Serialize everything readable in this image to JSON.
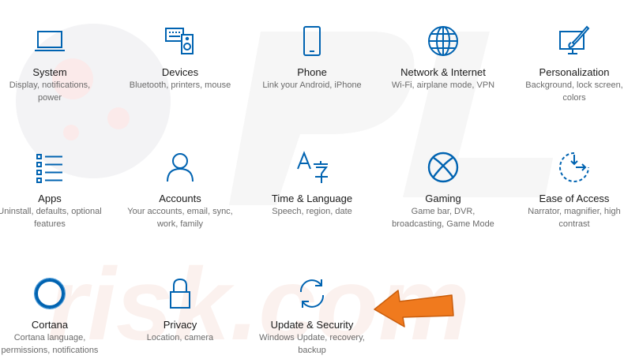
{
  "colors": {
    "accent": "#0063b1",
    "arrow": "#f07a1e"
  },
  "tiles": [
    {
      "title": "System",
      "desc1": "Display, notifications,",
      "desc2": "power",
      "icon": "laptop-icon"
    },
    {
      "title": "Devices",
      "desc1": "Bluetooth, printers, mouse",
      "desc2": "",
      "icon": "keyboard-speaker-icon"
    },
    {
      "title": "Phone",
      "desc1": "Link your Android, iPhone",
      "desc2": "",
      "icon": "phone-icon"
    },
    {
      "title": "Network & Internet",
      "desc1": "Wi-Fi, airplane mode, VPN",
      "desc2": "",
      "icon": "globe-icon"
    },
    {
      "title": "Personalization",
      "desc1": "Background, lock screen,",
      "desc2": "colors",
      "icon": "paint-brush-icon"
    },
    {
      "title": "Apps",
      "desc1": "Uninstall, defaults, optional",
      "desc2": "features",
      "icon": "apps-list-icon"
    },
    {
      "title": "Accounts",
      "desc1": "Your accounts, email, sync,",
      "desc2": "work, family",
      "icon": "person-icon"
    },
    {
      "title": "Time & Language",
      "desc1": "Speech, region, date",
      "desc2": "",
      "icon": "time-language-icon"
    },
    {
      "title": "Gaming",
      "desc1": "Game bar, DVR,",
      "desc2": "broadcasting, Game Mode",
      "icon": "xbox-icon"
    },
    {
      "title": "Ease of Access",
      "desc1": "Narrator, magnifier, high",
      "desc2": "contrast",
      "icon": "ease-of-access-icon"
    },
    {
      "title": "Cortana",
      "desc1": "Cortana language,",
      "desc2": "permissions, notifications",
      "icon": "cortana-icon"
    },
    {
      "title": "Privacy",
      "desc1": "Location, camera",
      "desc2": "",
      "icon": "lock-icon"
    },
    {
      "title": "Update & Security",
      "desc1": "Windows Update, recovery,",
      "desc2": "backup",
      "icon": "sync-icon"
    }
  ]
}
